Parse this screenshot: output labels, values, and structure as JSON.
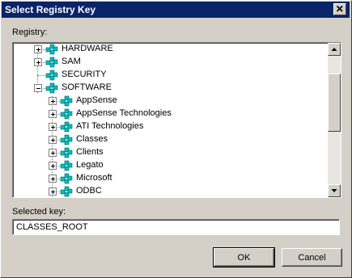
{
  "window": {
    "title": "Select Registry Key"
  },
  "labels": {
    "registry": "Registry:",
    "selected_key": "Selected key:"
  },
  "tree": {
    "top_level": [
      {
        "label": "HARDWARE",
        "expander": "plus"
      },
      {
        "label": "SAM",
        "expander": "plus"
      },
      {
        "label": "SECURITY",
        "expander": "none"
      },
      {
        "label": "SOFTWARE",
        "expander": "minus"
      }
    ],
    "software_children": [
      {
        "label": "AppSense",
        "expander": "plus"
      },
      {
        "label": "AppSense Technologies",
        "expander": "plus"
      },
      {
        "label": "ATI Technologies",
        "expander": "plus"
      },
      {
        "label": "Classes",
        "expander": "plus"
      },
      {
        "label": "Clients",
        "expander": "plus"
      },
      {
        "label": "Legato",
        "expander": "plus"
      },
      {
        "label": "Microsoft",
        "expander": "plus"
      },
      {
        "label": "ODBC",
        "expander": "plus"
      }
    ]
  },
  "selected_key": {
    "value": "CLASSES_ROOT"
  },
  "buttons": {
    "ok": "OK",
    "cancel": "Cancel"
  },
  "colors": {
    "titlebar": "#0a246a",
    "dialog": "#d4d0c8",
    "icon_teal": "#00c0c0"
  }
}
